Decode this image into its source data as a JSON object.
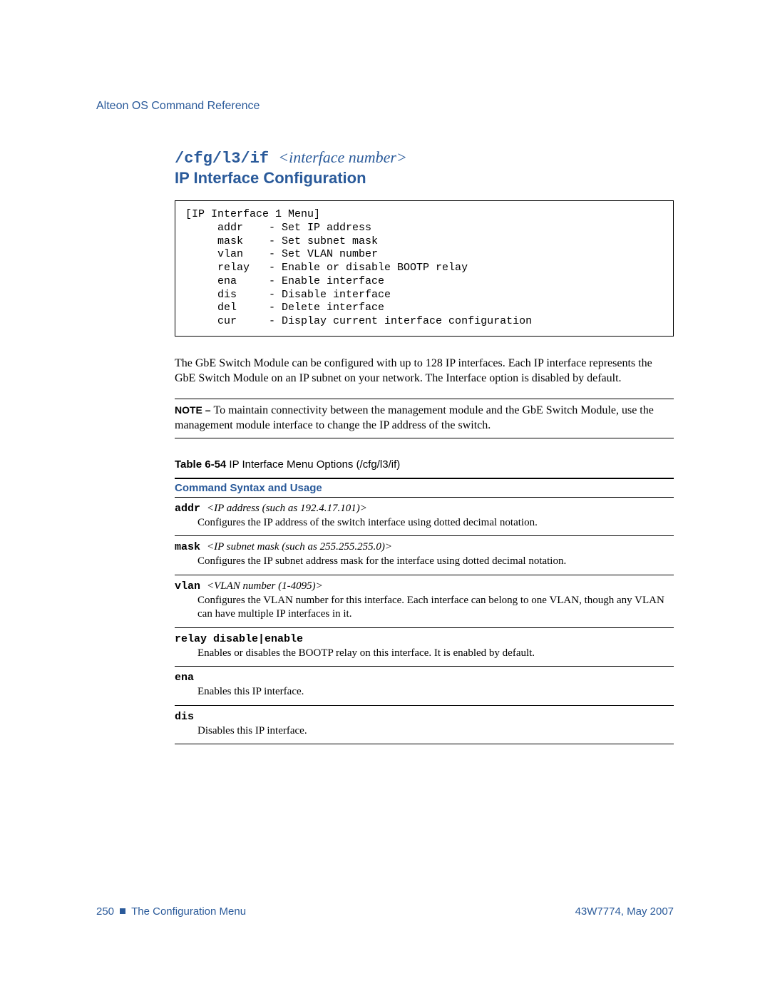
{
  "header": "Alteon OS Command Reference",
  "title": {
    "path": "/cfg/l3/if ",
    "arg": "<interface number>",
    "name": "IP Interface Configuration"
  },
  "menu": "[IP Interface 1 Menu]\n     addr    - Set IP address\n     mask    - Set subnet mask\n     vlan    - Set VLAN number\n     relay   - Enable or disable BOOTP relay\n     ena     - Enable interface\n     dis     - Disable interface\n     del     - Delete interface\n     cur     - Display current interface configuration",
  "body": {
    "p1a": "The ",
    "p1b": "GbE Switch Module",
    "p1c": " can be configured with up to 128 IP interfaces. Each IP interface represents the ",
    "p1d": "GbE Switch Module",
    "p1e": " on an IP subnet on your network. The Interface option is disabled by  default."
  },
  "note": {
    "label": "NOTE – ",
    "text": "To maintain connectivity between the management module and the GbE Switch Module, use the management module interface to change the IP address of the switch."
  },
  "table": {
    "caption_bold": "Table 6-54",
    "caption_rest": "  IP Interface Menu Options (/cfg/l3/if)",
    "header": "Command Syntax and Usage",
    "rows": [
      {
        "cmd": "addr ",
        "arg": "<IP address (such as 192.4.17.101)>",
        "desc": "Configures the IP address of the switch interface using dotted decimal notation."
      },
      {
        "cmd": "mask ",
        "arg": "<IP subnet mask (such as 255.255.255.0)>",
        "desc": "Configures the IP subnet address mask for the interface using dotted decimal notation."
      },
      {
        "cmd": "vlan ",
        "arg": "<VLAN number (1-4095)>",
        "desc": "Configures the VLAN number for this interface. Each interface can belong to one VLAN, though any VLAN can have multiple IP interfaces in it."
      },
      {
        "cmd": "relay disable|enable",
        "arg": "",
        "desc": "Enables or disables the BOOTP relay on this interface. It is enabled by default."
      },
      {
        "cmd": "ena",
        "arg": "",
        "desc": "Enables this IP interface."
      },
      {
        "cmd": "dis",
        "arg": "",
        "desc": "Disables this IP interface."
      }
    ]
  },
  "footer": {
    "left_page": "250",
    "left_text": "The Configuration Menu",
    "right": "43W7774, May 2007"
  }
}
